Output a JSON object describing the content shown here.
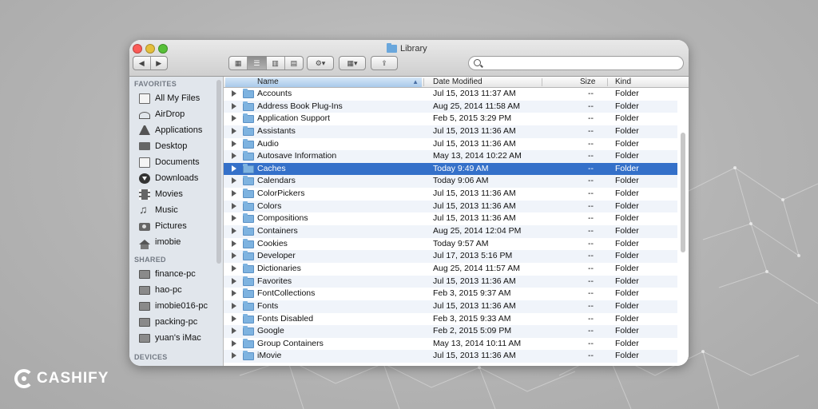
{
  "window": {
    "title": "Library"
  },
  "toolbar": {
    "nav": {
      "back_icon": "chevron-left-icon",
      "forward_icon": "chevron-right-icon"
    },
    "views": [
      "icon-view-icon",
      "list-view-icon",
      "column-view-icon",
      "coverflow-view-icon"
    ],
    "active_view": "list-view-icon",
    "action_icon": "gear-icon",
    "arrange_icon": "arrange-icon",
    "share_icon": "share-icon",
    "search": {
      "placeholder": "",
      "value": ""
    }
  },
  "sidebar": {
    "sections": [
      {
        "header": "FAVORITES",
        "items": [
          {
            "label": "All My Files",
            "icon": "all-files-icon"
          },
          {
            "label": "AirDrop",
            "icon": "airdrop-icon"
          },
          {
            "label": "Applications",
            "icon": "applications-icon"
          },
          {
            "label": "Desktop",
            "icon": "desktop-icon"
          },
          {
            "label": "Documents",
            "icon": "documents-icon"
          },
          {
            "label": "Downloads",
            "icon": "downloads-icon"
          },
          {
            "label": "Movies",
            "icon": "movies-icon"
          },
          {
            "label": "Music",
            "icon": "music-icon"
          },
          {
            "label": "Pictures",
            "icon": "pictures-icon"
          },
          {
            "label": "imobie",
            "icon": "home-icon"
          }
        ]
      },
      {
        "header": "SHARED",
        "items": [
          {
            "label": "finance-pc",
            "icon": "computer-icon"
          },
          {
            "label": "hao-pc",
            "icon": "computer-icon"
          },
          {
            "label": "imobie016-pc",
            "icon": "computer-icon"
          },
          {
            "label": "packing-pc",
            "icon": "computer-icon"
          },
          {
            "label": "yuan's iMac",
            "icon": "computer-icon"
          }
        ]
      },
      {
        "header": "DEVICES",
        "items": []
      }
    ]
  },
  "list": {
    "columns": {
      "name": "Name",
      "date": "Date Modified",
      "size": "Size",
      "kind": "Kind"
    },
    "selected_index": 6,
    "rows": [
      {
        "name": "Accounts",
        "date": "Jul 15, 2013 11:37 AM",
        "size": "--",
        "kind": "Folder"
      },
      {
        "name": "Address Book Plug-Ins",
        "date": "Aug 25, 2014 11:58 AM",
        "size": "--",
        "kind": "Folder"
      },
      {
        "name": "Application Support",
        "date": "Feb 5, 2015 3:29 PM",
        "size": "--",
        "kind": "Folder"
      },
      {
        "name": "Assistants",
        "date": "Jul 15, 2013 11:36 AM",
        "size": "--",
        "kind": "Folder"
      },
      {
        "name": "Audio",
        "date": "Jul 15, 2013 11:36 AM",
        "size": "--",
        "kind": "Folder"
      },
      {
        "name": "Autosave Information",
        "date": "May 13, 2014 10:22 AM",
        "size": "--",
        "kind": "Folder"
      },
      {
        "name": "Caches",
        "date": "Today 9:49 AM",
        "size": "--",
        "kind": "Folder"
      },
      {
        "name": "Calendars",
        "date": "Today 9:06 AM",
        "size": "--",
        "kind": "Folder"
      },
      {
        "name": "ColorPickers",
        "date": "Jul 15, 2013 11:36 AM",
        "size": "--",
        "kind": "Folder"
      },
      {
        "name": "Colors",
        "date": "Jul 15, 2013 11:36 AM",
        "size": "--",
        "kind": "Folder"
      },
      {
        "name": "Compositions",
        "date": "Jul 15, 2013 11:36 AM",
        "size": "--",
        "kind": "Folder"
      },
      {
        "name": "Containers",
        "date": "Aug 25, 2014 12:04 PM",
        "size": "--",
        "kind": "Folder"
      },
      {
        "name": "Cookies",
        "date": "Today 9:57 AM",
        "size": "--",
        "kind": "Folder"
      },
      {
        "name": "Developer",
        "date": "Jul 17, 2013 5:16 PM",
        "size": "--",
        "kind": "Folder"
      },
      {
        "name": "Dictionaries",
        "date": "Aug 25, 2014 11:57 AM",
        "size": "--",
        "kind": "Folder"
      },
      {
        "name": "Favorites",
        "date": "Jul 15, 2013 11:36 AM",
        "size": "--",
        "kind": "Folder"
      },
      {
        "name": "FontCollections",
        "date": "Feb 3, 2015 9:37 AM",
        "size": "--",
        "kind": "Folder"
      },
      {
        "name": "Fonts",
        "date": "Jul 15, 2013 11:36 AM",
        "size": "--",
        "kind": "Folder"
      },
      {
        "name": "Fonts Disabled",
        "date": "Feb 3, 2015 9:33 AM",
        "size": "--",
        "kind": "Folder"
      },
      {
        "name": "Google",
        "date": "Feb 2, 2015 5:09 PM",
        "size": "--",
        "kind": "Folder"
      },
      {
        "name": "Group Containers",
        "date": "May 13, 2014 10:11 AM",
        "size": "--",
        "kind": "Folder"
      },
      {
        "name": "iMovie",
        "date": "Jul 15, 2013 11:36 AM",
        "size": "--",
        "kind": "Folder"
      }
    ]
  },
  "brand": {
    "logo_text": "CASHIFY"
  },
  "colors": {
    "selection": "#3470c9",
    "sidebar_bg": "#e1e6ec",
    "alt_row": "#f0f4fa"
  }
}
